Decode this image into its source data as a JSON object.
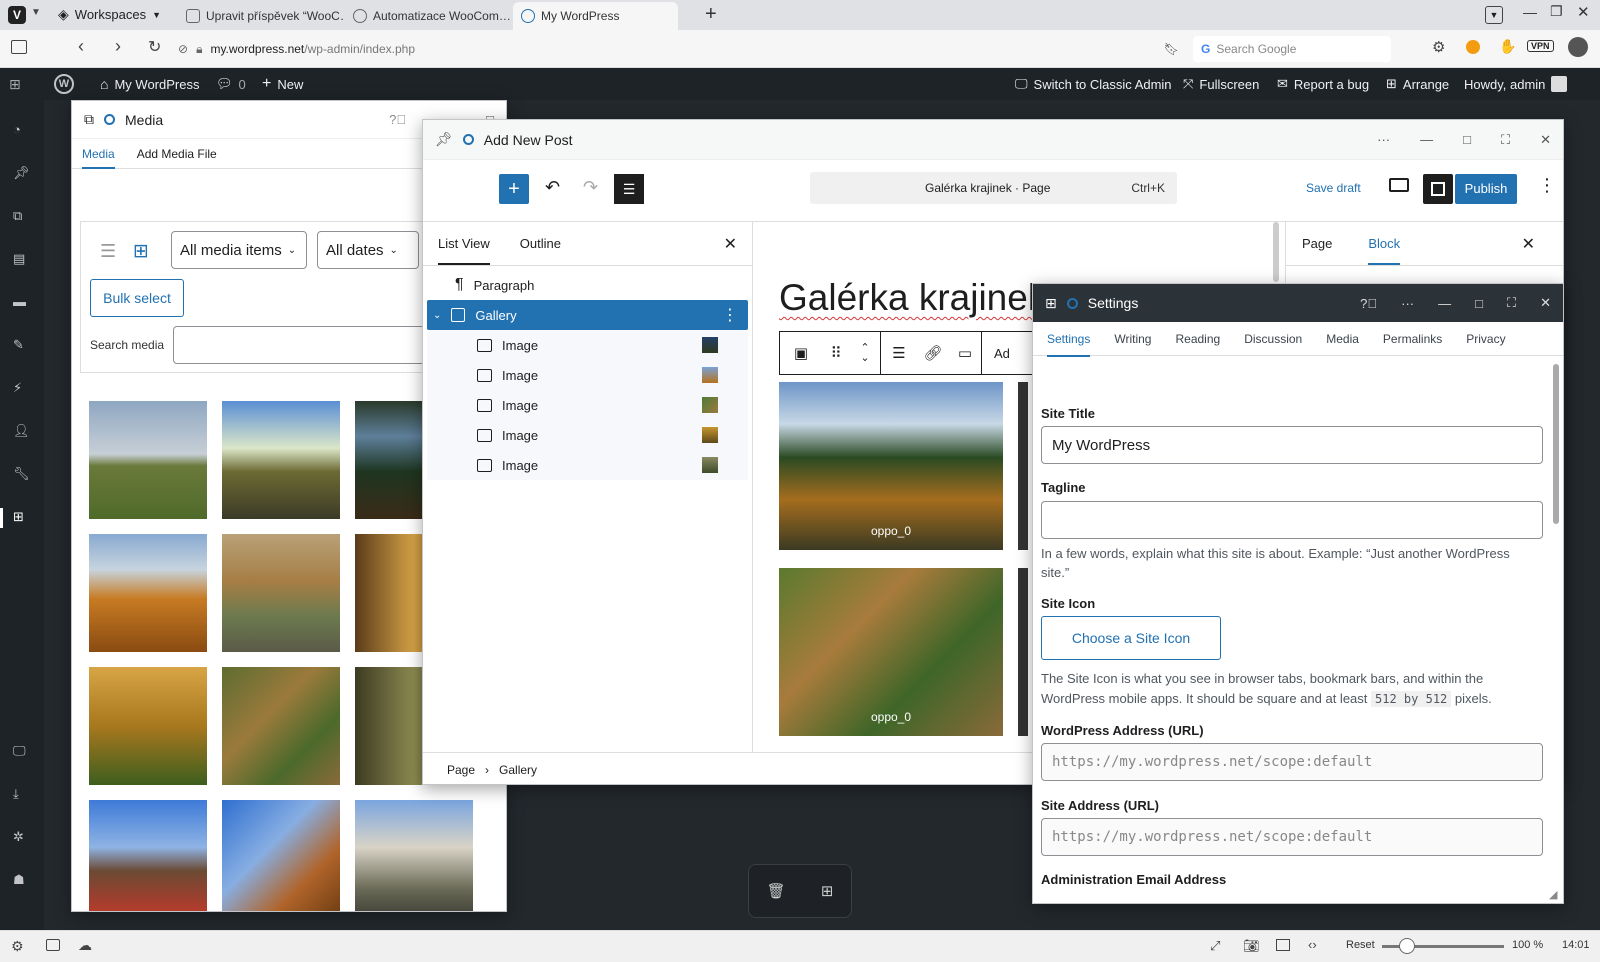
{
  "browser": {
    "workspaces_label": "Workspaces",
    "tabs": [
      {
        "label": "Upravit příspěvek “WooC…"
      },
      {
        "label": "Automatizace WooCom…"
      },
      {
        "label": "My WordPress"
      }
    ],
    "url_host": "my.wordpress.net",
    "url_path": "/wp-admin/index.php",
    "search_placeholder": "Search Google",
    "vpn_label": "VPN"
  },
  "adminbar": {
    "site_name": "My WordPress",
    "comments_count": "0",
    "new_label": "New",
    "switch_classic": "Switch to Classic Admin",
    "fullscreen": "Fullscreen",
    "report_bug": "Report a bug",
    "arrange": "Arrange",
    "howdy": "Howdy, admin"
  },
  "media_window": {
    "title": "Media",
    "tabs": [
      "Media",
      "Add Media File"
    ],
    "filter_type": "All media items",
    "filter_date": "All dates",
    "bulk_select": "Bulk select",
    "search_label": "Search media"
  },
  "editor_window": {
    "title": "Add New Post",
    "doc_title": "Galérka krajinek · Page",
    "shortcut": "Ctrl+K",
    "save_draft": "Save draft",
    "publish": "Publish",
    "list_tabs": [
      "List View",
      "Outline"
    ],
    "list_items": [
      {
        "label": "Paragraph"
      },
      {
        "label": "Gallery"
      },
      {
        "label": "Image"
      },
      {
        "label": "Image"
      },
      {
        "label": "Image"
      },
      {
        "label": "Image"
      },
      {
        "label": "Image"
      }
    ],
    "heading": "Galérka krajinek",
    "caption": "oppo_0",
    "toolbar_partial": "Ad",
    "sidebar_tabs": [
      "Page",
      "Block"
    ],
    "breadcrumb": [
      "Page",
      "Gallery"
    ]
  },
  "settings_window": {
    "title": "Settings",
    "tabs": [
      "Settings",
      "Writing",
      "Reading",
      "Discussion",
      "Media",
      "Permalinks",
      "Privacy"
    ],
    "site_title_label": "Site Title",
    "site_title_value": "My WordPress",
    "tagline_label": "Tagline",
    "tagline_help": "In a few words, explain what this site is about. Example: “Just another WordPress site.”",
    "site_icon_label": "Site Icon",
    "site_icon_button": "Choose a Site Icon",
    "site_icon_help_1": "The Site Icon is what you see in browser tabs, bookmark bars, and within the WordPress mobile apps. It should be square and at least",
    "site_icon_code": "512 by 512",
    "site_icon_help_2": "pixels.",
    "wp_address_label": "WordPress Address (URL)",
    "wp_address_value": "https://my.wordpress.net/scope:default",
    "site_address_label": "Site Address (URL)",
    "site_address_value": "https://my.wordpress.net/scope:default",
    "admin_email_label": "Administration Email Address"
  },
  "statusbar": {
    "reset": "Reset",
    "zoom": "100 %",
    "time": "14:01"
  },
  "colors": {
    "accent": "#2271b1",
    "admin_bg": "#1d2327"
  }
}
